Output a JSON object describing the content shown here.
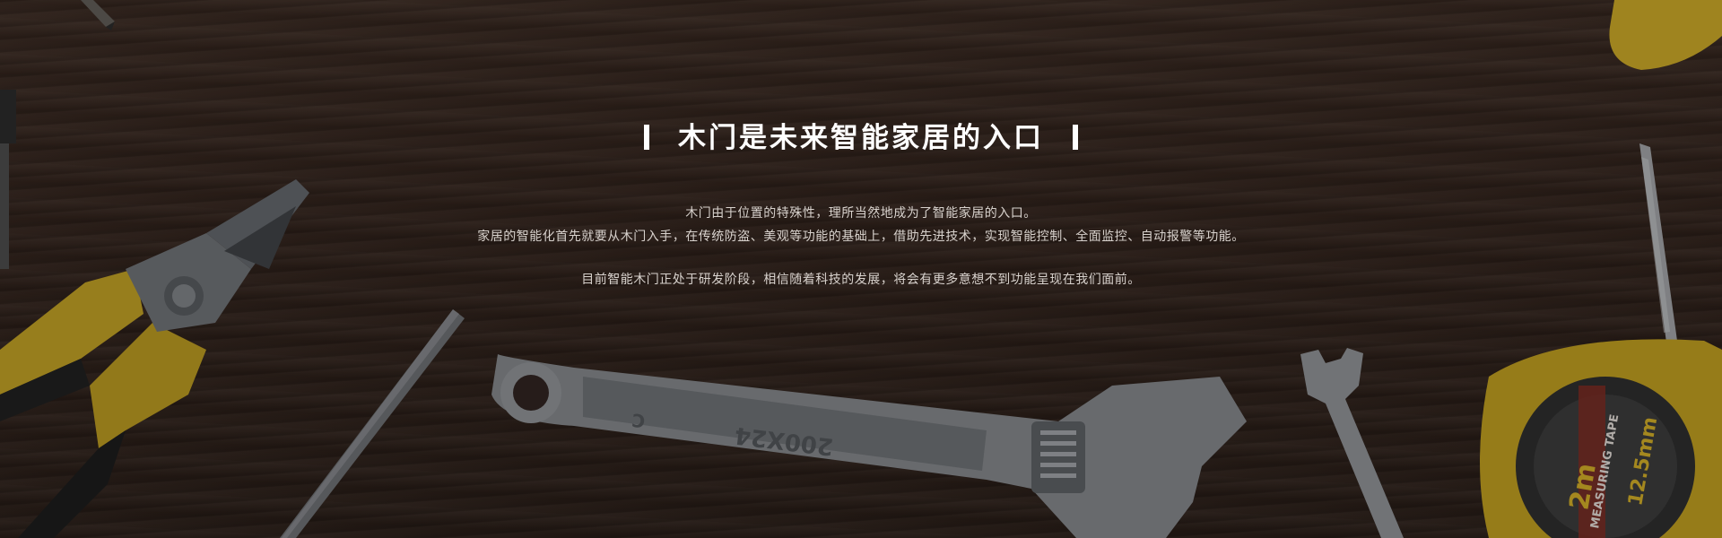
{
  "hero": {
    "title": "木门是未来智能家居的入口",
    "paragraph_lines": [
      "木门由于位置的特殊性，理所当然地成为了智能家居的入口。",
      "家居的智能化首先就要从木门入手，在传统防盗、美观等功能的基础上，借助先进技术，实现智能控制、全面监控、自动报警等功能。",
      "目前智能木门正处于研发阶段，相信随着科技的发展，将会有更多意想不到功能呈现在我们面前。"
    ]
  },
  "tools": {
    "wrench_marking": "200X24",
    "wrench_letter": "C",
    "tape_size": "2m",
    "tape_label": "MEASURING TAPE",
    "tape_width": "12.5mm"
  },
  "colors": {
    "wood": "#33241d",
    "tool_yellow": "#c9a626",
    "steel": "#8c8f93",
    "text_white": "#ffffff"
  }
}
